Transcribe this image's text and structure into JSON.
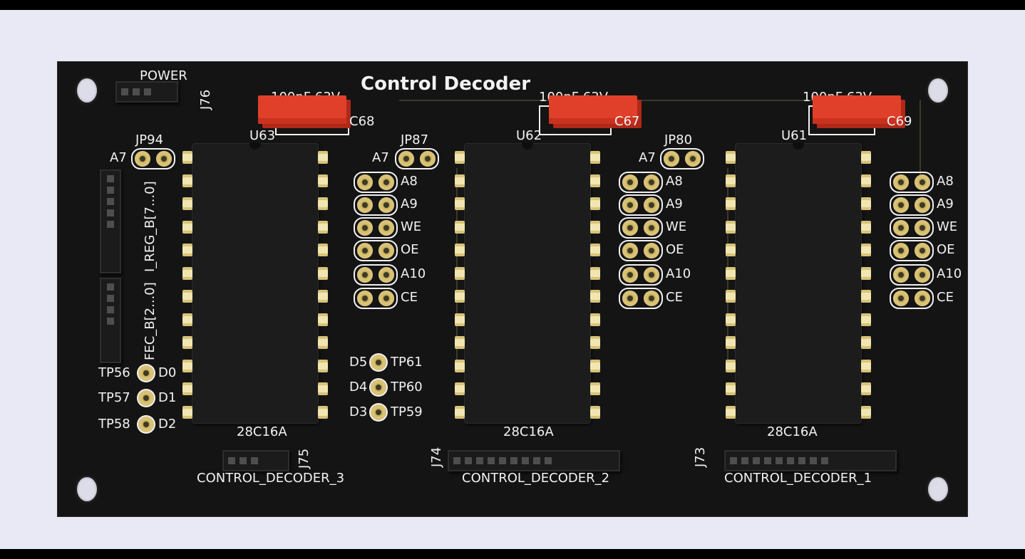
{
  "board": {
    "title": "Control Decoder",
    "power_label": "POWER",
    "power_ref": "J76"
  },
  "chips": [
    {
      "ref": "U63",
      "part": "28C16A",
      "cap_ref": "C68",
      "cap_value": "100nF 63V",
      "jumper_ref": "JP94"
    },
    {
      "ref": "U62",
      "part": "28C16A",
      "cap_ref": "C67",
      "cap_value": "100nF 63V",
      "jumper_ref": "JP87"
    },
    {
      "ref": "U61",
      "part": "28C16A",
      "cap_ref": "C69",
      "cap_value": "100nF 63V",
      "jumper_ref": "JP80"
    }
  ],
  "jumper_labels": [
    "A7",
    "A8",
    "A9",
    "WE",
    "OE",
    "A10",
    "CE"
  ],
  "connectors": {
    "j75": {
      "ref": "J75",
      "label": "CONTROL_DECODER_3"
    },
    "j74": {
      "ref": "J74",
      "label": "CONTROL_DECODER_2"
    },
    "j73": {
      "ref": "J73",
      "label": "CONTROL_DECODER_1"
    },
    "reg_bus": "I_REG_B[7...0]",
    "fec_bus": "FEC_B[2...0]"
  },
  "testpoints": {
    "left": [
      {
        "ref": "TP56",
        "net": "D0"
      },
      {
        "ref": "TP57",
        "net": "D1"
      },
      {
        "ref": "TP58",
        "net": "D2"
      }
    ],
    "mid": [
      {
        "ref": "TP61",
        "net": "D5"
      },
      {
        "ref": "TP60",
        "net": "D4"
      },
      {
        "ref": "TP59",
        "net": "D3"
      }
    ]
  },
  "colors": {
    "board": "#141414",
    "silkscreen": "#f2f2f2",
    "pad_gold": "#d9c278",
    "capacitor": "#e0402a"
  }
}
